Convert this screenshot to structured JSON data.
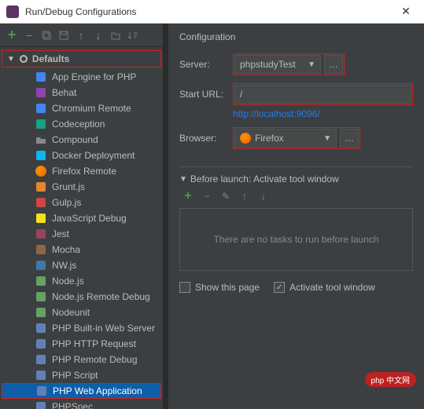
{
  "titlebar": {
    "title": "Run/Debug Configurations"
  },
  "left": {
    "defaults_label": "Defaults",
    "items": [
      {
        "label": "App Engine for PHP",
        "icon": "ae",
        "sel": false
      },
      {
        "label": "Behat",
        "icon": "behat",
        "sel": false
      },
      {
        "label": "Chromium Remote",
        "icon": "chrome",
        "sel": false
      },
      {
        "label": "Codeception",
        "icon": "code",
        "sel": false
      },
      {
        "label": "Compound",
        "icon": "folder",
        "sel": false
      },
      {
        "label": "Docker Deployment",
        "icon": "docker",
        "sel": false
      },
      {
        "label": "Firefox Remote",
        "icon": "firefox",
        "sel": false
      },
      {
        "label": "Grunt.js",
        "icon": "grunt",
        "sel": false
      },
      {
        "label": "Gulp.js",
        "icon": "gulp",
        "sel": false
      },
      {
        "label": "JavaScript Debug",
        "icon": "jsdbg",
        "sel": false
      },
      {
        "label": "Jest",
        "icon": "jest",
        "sel": false
      },
      {
        "label": "Mocha",
        "icon": "mocha",
        "sel": false
      },
      {
        "label": "NW.js",
        "icon": "nw",
        "sel": false
      },
      {
        "label": "Node.js",
        "icon": "node",
        "sel": false
      },
      {
        "label": "Node.js Remote Debug",
        "icon": "nodedbg",
        "sel": false
      },
      {
        "label": "Nodeunit",
        "icon": "nodeunit",
        "sel": false
      },
      {
        "label": "PHP Built-in Web Server",
        "icon": "php",
        "sel": false
      },
      {
        "label": "PHP HTTP Request",
        "icon": "php",
        "sel": false
      },
      {
        "label": "PHP Remote Debug",
        "icon": "php",
        "sel": false
      },
      {
        "label": "PHP Script",
        "icon": "php",
        "sel": false
      },
      {
        "label": "PHP Web Application",
        "icon": "php",
        "sel": true
      },
      {
        "label": "PHPSpec",
        "icon": "phpspec",
        "sel": false
      }
    ]
  },
  "right": {
    "heading": "Configuration",
    "server_label": "Server:",
    "server_value": "phpstudyTest",
    "starturl_label": "Start URL:",
    "starturl_value": "/",
    "url_preview": "http://localhost:9096/",
    "browser_label": "Browser:",
    "browser_value": "Firefox",
    "before_launch_label": "Before launch: Activate tool window",
    "no_tasks": "There are no tasks to run before launch",
    "show_page_label": "Show this page",
    "activate_tool_label": "Activate tool window"
  },
  "watermark": "php 中文网"
}
